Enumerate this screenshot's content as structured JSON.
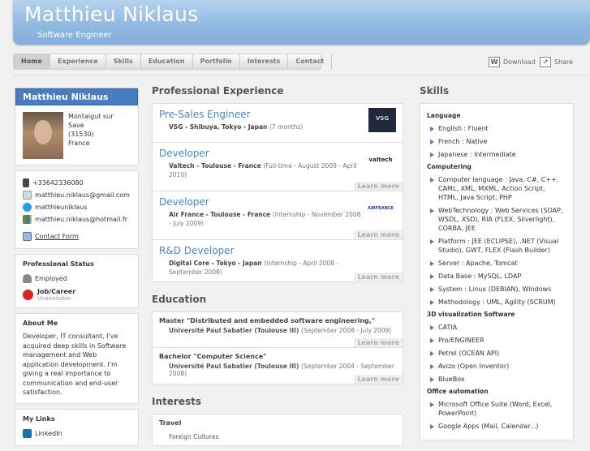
{
  "header": {
    "name": "Matthieu Niklaus",
    "subtitle": "Software Engineer"
  },
  "nav": [
    "Home",
    "Experience",
    "Skills",
    "Education",
    "Portfolio",
    "Interests",
    "Contact"
  ],
  "tools": {
    "download": "Download",
    "share": "Share"
  },
  "profile": {
    "name": "Matthieu Niklaus",
    "location": [
      "Montaigut sur Save",
      "(31530)",
      "France"
    ],
    "contacts": [
      "+33642336080",
      "matthieu.niklaus@gmail.com",
      "matthieuniklaus",
      "matthieu.niklaus@hotmail.fr"
    ],
    "contact_form": "Contact Form"
  },
  "status": {
    "title": "Professional Status",
    "employed": "Employed",
    "job_label": "Job/Career",
    "job_value": "Unavailable"
  },
  "about": {
    "title": "About Me",
    "text": "Developer, IT consultant, I've acquired deep skills in Software management and Web application development. I'm giving a real importance to communication and end-user satisfaction."
  },
  "links": {
    "title": "My Links",
    "items": [
      "LinkedIn"
    ]
  },
  "experience": {
    "title": "Professional Experience",
    "more": "Learn more",
    "jobs": [
      {
        "title": "Pre-Sales Engineer",
        "company": "VSG - Shibuya, Tokyo - Japan",
        "detail": "(7 months)",
        "logo": "VSG"
      },
      {
        "title": "Developer",
        "company": "Valtech - Toulouse - France",
        "detail": "(Full-time - August 2009 - April 2010)",
        "logo": "valtech"
      },
      {
        "title": "Developer",
        "company": "Air France - Toulouse - France",
        "detail": "(Internship - November 2008 - July 2009)",
        "logo": "AIRFRANCE"
      },
      {
        "title": "R&D Developer",
        "company": "Digital Core - Tokyo - Japan",
        "detail": "(Internship - April 2008 - September 2008)",
        "logo": ""
      }
    ]
  },
  "education": {
    "title": "Education",
    "more": "Learn more",
    "items": [
      {
        "title": "Master \"Distributed and embedded software engineering,\"",
        "school": "Université Paul Sabatier (Toulouse III)",
        "dates": "(September 2008 - July 2009)"
      },
      {
        "title": "Bachelor \"Computer Science\"",
        "school": "Université Paul Sabatier (Toulouse III)",
        "dates": "(September 2004 - September 2008)"
      }
    ]
  },
  "interests": {
    "title": "Interests",
    "sub": "Travel",
    "item": "Foreign Cultures"
  },
  "skills": {
    "title": "Skills",
    "groups": [
      {
        "name": "Language",
        "items": [
          "English : Fluent",
          "French : Native",
          "Japanese : Intermediate"
        ]
      },
      {
        "name": "Computering",
        "items": [
          "Computer language : Java, C#, C++, CAML, XML, MXML, Action Script, HTML, Java Script, PHP",
          "WebTechnology : Web Services (SOAP, WSDL, XSD), RIA (FLEX, Silverlight), CORBA, JEE",
          "Platform : JEE (ECLIPSE), .NET (Visual Studio), GWT, FLEX (Flash Builder)",
          "Server : Apache, Tomcat",
          "Data Base : MySQL, LDAP",
          "System : Linux (DEBIAN), Windows",
          "Methodology : UML, Agility (SCRUM)"
        ]
      },
      {
        "name": "3D visualization Software",
        "items": [
          "CATIA",
          "Pro/ENGINEER",
          "Petrel (OCEAN API)",
          "Avizo (Open Inventor)",
          "BlueBox"
        ]
      },
      {
        "name": "Office automation",
        "items": [
          "Microsoft Office Suite (Word, Excel, PowerPoint)",
          "Google Apps (Mail, Calendar...)"
        ]
      }
    ]
  }
}
